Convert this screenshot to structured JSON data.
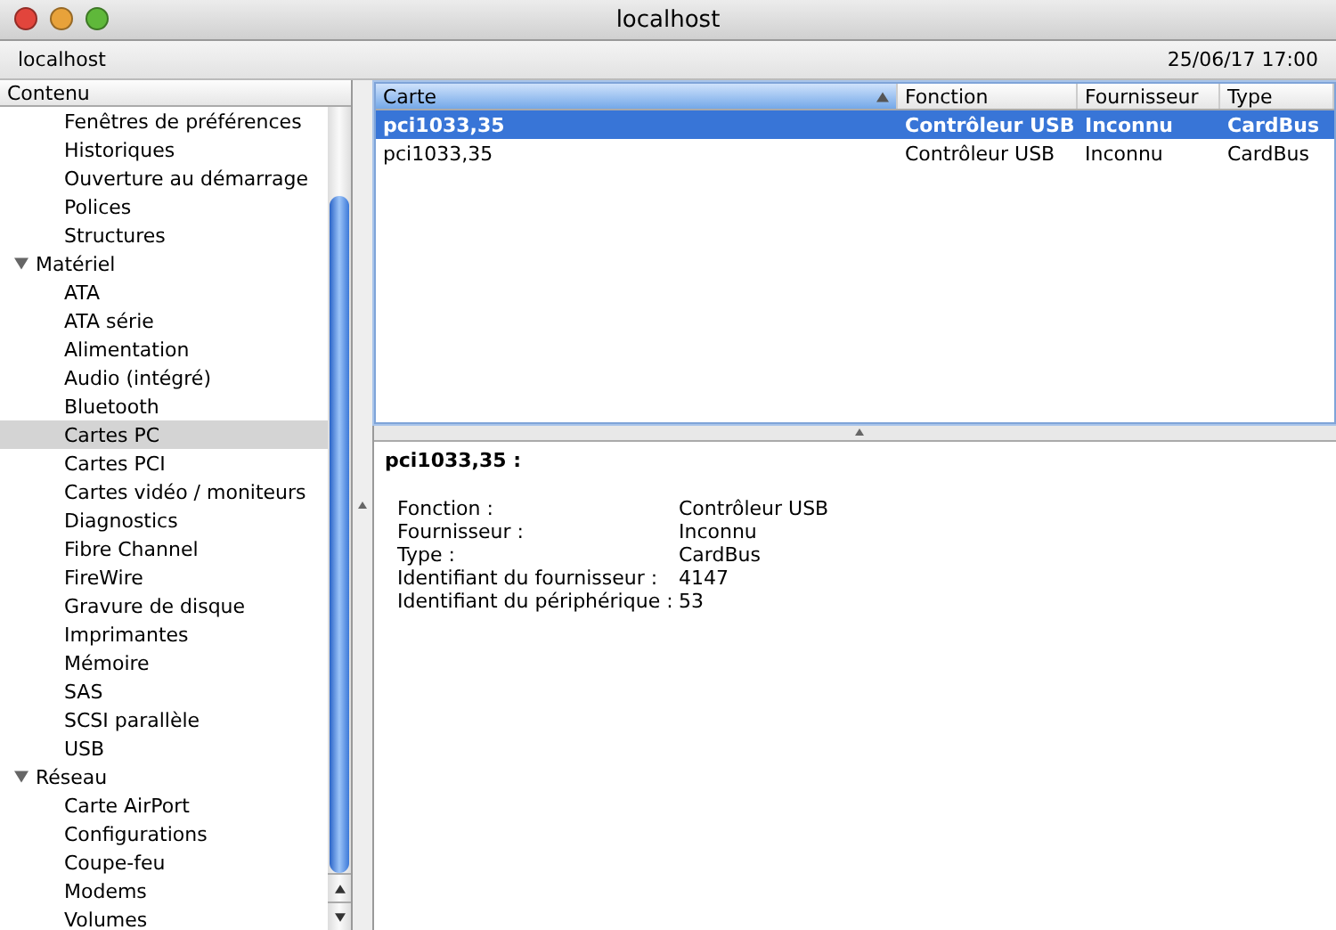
{
  "window": {
    "title": "localhost"
  },
  "info_bar": {
    "computer": "localhost",
    "date": "25/06/17 17:00"
  },
  "sidebar": {
    "header": "Contenu",
    "sections": [
      {
        "children": [
          {
            "label": "Fenêtres de préférences",
            "selected": false
          },
          {
            "label": "Historiques",
            "selected": false
          },
          {
            "label": "Ouverture au démarrage",
            "selected": false
          },
          {
            "label": "Polices",
            "selected": false
          },
          {
            "label": "Structures",
            "selected": false
          }
        ]
      },
      {
        "label": "Matériel",
        "expanded": true,
        "children": [
          {
            "label": "ATA",
            "selected": false
          },
          {
            "label": "ATA série",
            "selected": false
          },
          {
            "label": "Alimentation",
            "selected": false
          },
          {
            "label": "Audio (intégré)",
            "selected": false
          },
          {
            "label": "Bluetooth",
            "selected": false
          },
          {
            "label": "Cartes PC",
            "selected": true
          },
          {
            "label": "Cartes PCI",
            "selected": false
          },
          {
            "label": "Cartes vidéo / moniteurs",
            "selected": false
          },
          {
            "label": "Diagnostics",
            "selected": false
          },
          {
            "label": "Fibre Channel",
            "selected": false
          },
          {
            "label": "FireWire",
            "selected": false
          },
          {
            "label": "Gravure de disque",
            "selected": false
          },
          {
            "label": "Imprimantes",
            "selected": false
          },
          {
            "label": "Mémoire",
            "selected": false
          },
          {
            "label": "SAS",
            "selected": false
          },
          {
            "label": "SCSI parallèle",
            "selected": false
          },
          {
            "label": "USB",
            "selected": false
          }
        ]
      },
      {
        "label": "Réseau",
        "expanded": true,
        "children": [
          {
            "label": "Carte AirPort",
            "selected": false
          },
          {
            "label": "Configurations",
            "selected": false
          },
          {
            "label": "Coupe-feu",
            "selected": false
          },
          {
            "label": "Modems",
            "selected": false
          },
          {
            "label": "Volumes",
            "selected": false
          }
        ]
      }
    ]
  },
  "table": {
    "columns": [
      {
        "label": "Carte",
        "sorted": true
      },
      {
        "label": "Fonction",
        "sorted": false
      },
      {
        "label": "Fournisseur",
        "sorted": false
      },
      {
        "label": "Type",
        "sorted": false
      }
    ],
    "rows": [
      {
        "cells": [
          "pci1033,35",
          "Contrôleur USB",
          "Inconnu",
          "CardBus"
        ],
        "selected": true
      },
      {
        "cells": [
          "pci1033,35",
          "Contrôleur USB",
          "Inconnu",
          "CardBus"
        ],
        "selected": false
      }
    ]
  },
  "detail": {
    "title": "pci1033,35 :",
    "fields": [
      {
        "label": "Fonction :",
        "value": "Contrôleur USB"
      },
      {
        "label": "Fournisseur :",
        "value": "Inconnu"
      },
      {
        "label": "Type :",
        "value": "CardBus"
      },
      {
        "label": "Identifiant du fournisseur :",
        "value": "4147"
      },
      {
        "label": "Identifiant du périphérique :",
        "value": "53"
      }
    ]
  }
}
